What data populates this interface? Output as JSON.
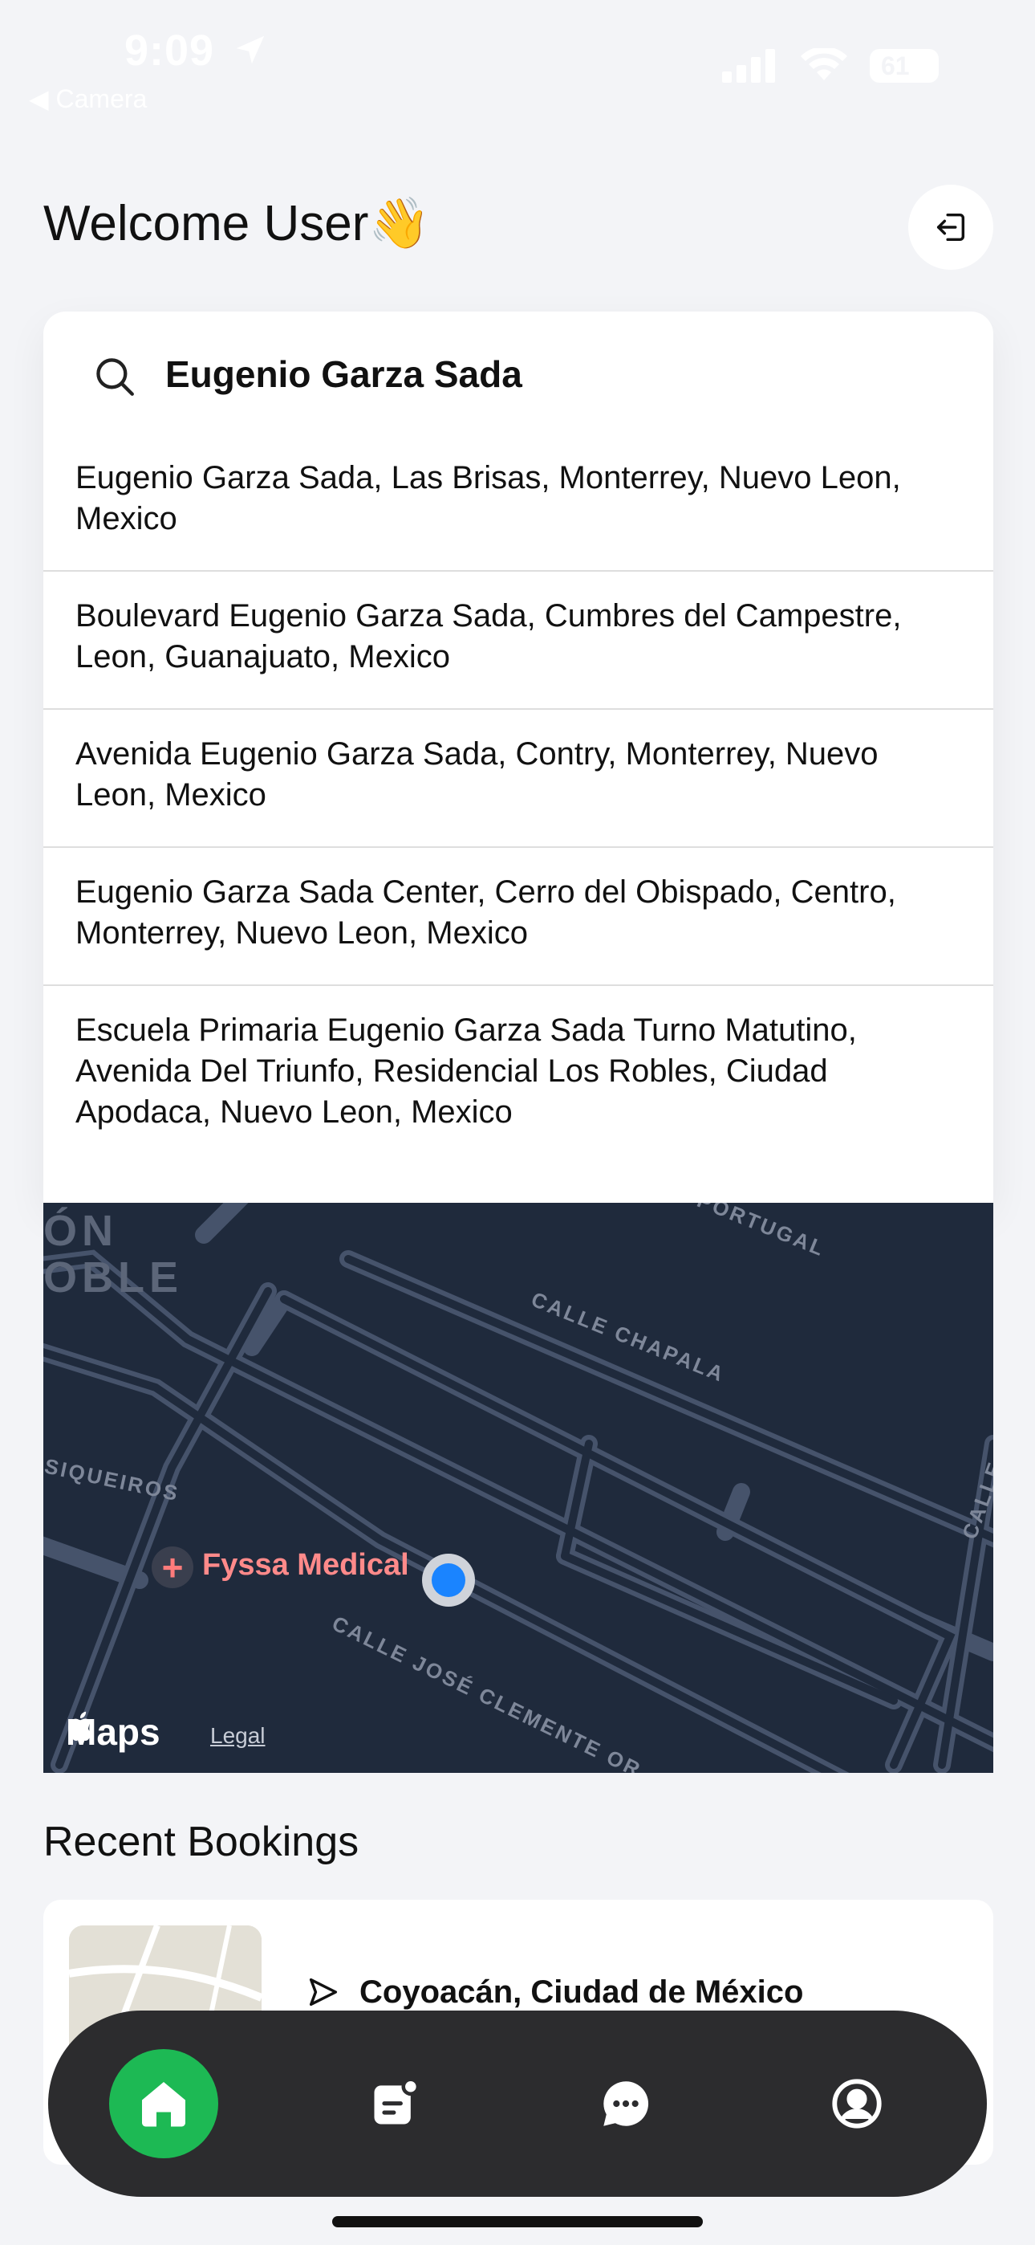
{
  "status_bar": {
    "time": "9:09",
    "back_app": "◀ Camera",
    "battery": "61"
  },
  "header": {
    "welcome": "Welcome User👋"
  },
  "search": {
    "value": "Eugenio Garza Sada",
    "suggestions": [
      "Eugenio Garza Sada, Las Brisas, Monterrey, Nuevo Leon, Mexico",
      "Boulevard Eugenio Garza Sada, Cumbres del Campestre, Leon, Guanajuato, Mexico",
      "Avenida Eugenio Garza Sada, Contry, Monterrey, Nuevo Leon, Mexico",
      "Eugenio Garza Sada Center, Cerro del Obispado, Centro, Monterrey, Nuevo Leon, Mexico",
      "Escuela Primaria Eugenio Garza Sada Turno Matutino, Avenida Del Triunfo, Residencial Los Robles, Ciudad Apodaca, Nuevo Leon, Mexico"
    ]
  },
  "map": {
    "district": "ÓN\nOBLE",
    "streets": [
      "PORTUGAL",
      "CALLE CHAPALA",
      "SIQUEIROS",
      "CALLE JOSÉ CLEMENTE OR",
      "CALLE A"
    ],
    "poi": "Fyssa Medical",
    "brand": "Maps",
    "legal": "Legal"
  },
  "recent": {
    "title": "Recent Bookings",
    "bookings": [
      {
        "place": "Coyoacán, Ciudad de México"
      }
    ]
  },
  "tabbar": {
    "tabs": [
      "home-icon",
      "bookings-icon",
      "chat-icon",
      "profile-icon"
    ],
    "active": "home-icon",
    "active_color": "#1db954"
  }
}
